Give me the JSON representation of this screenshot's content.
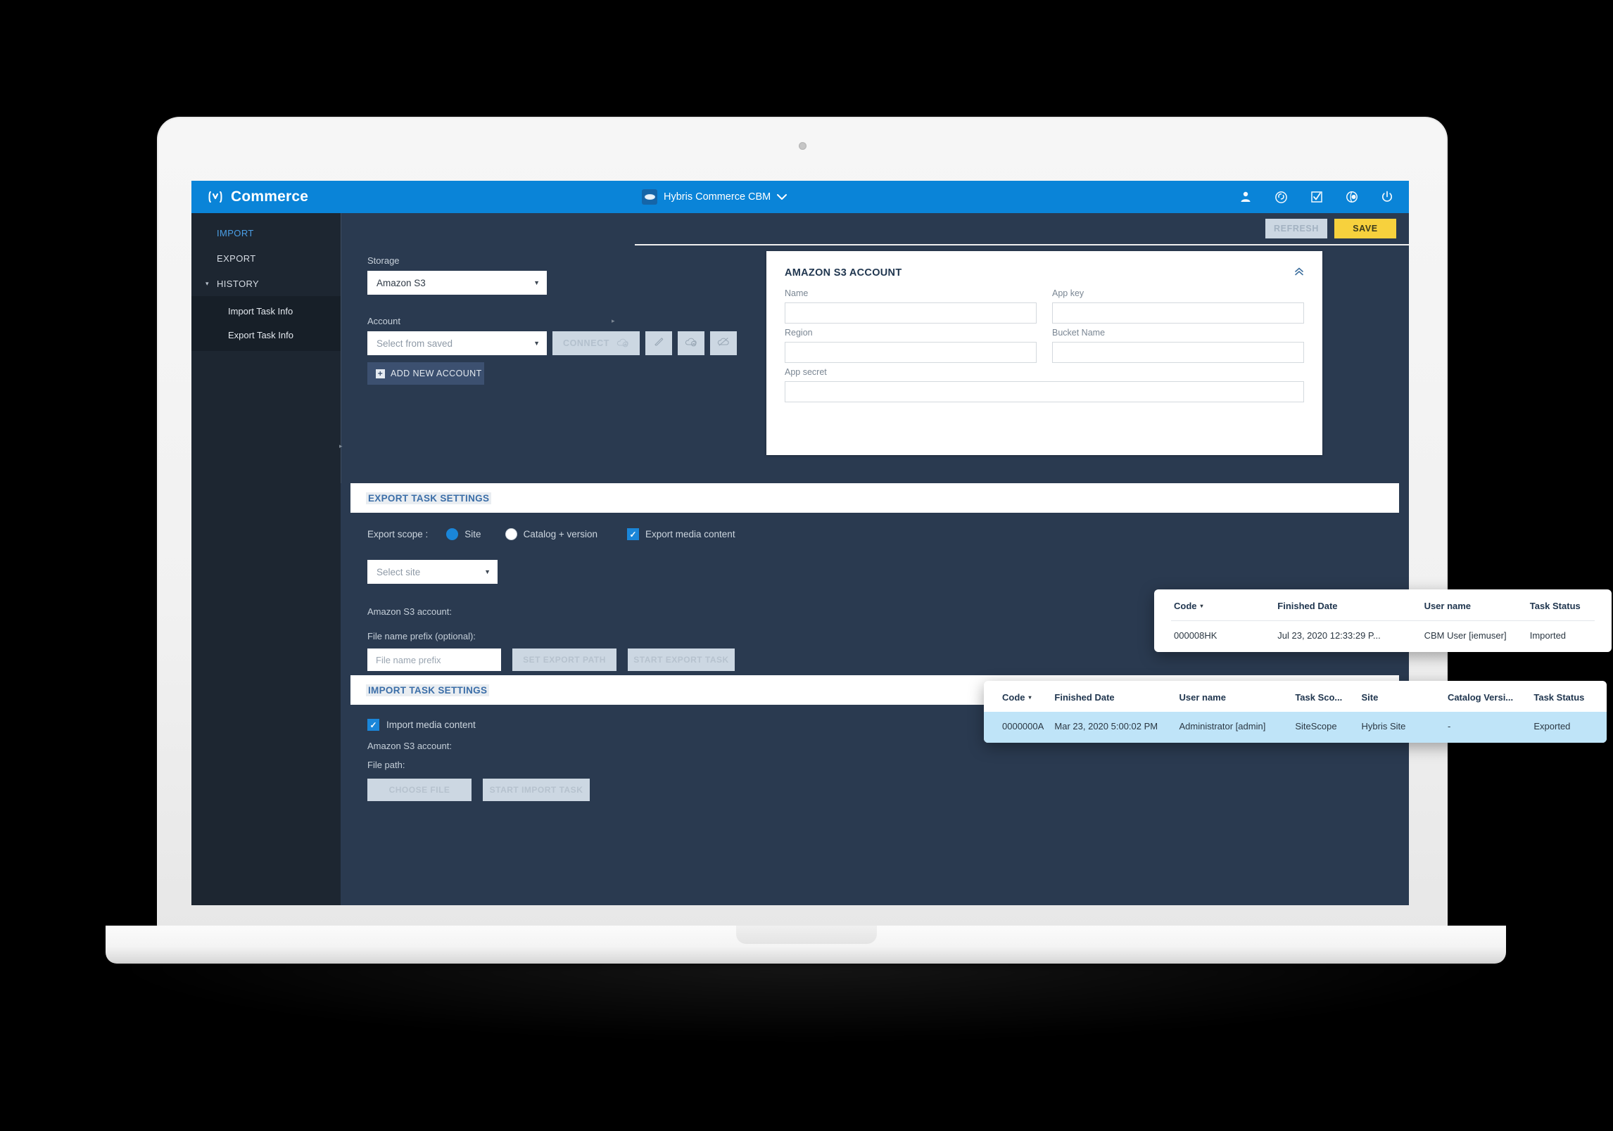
{
  "app": {
    "brand_title": "Commerce",
    "brand_logo_icon": "hybris-logo-icon",
    "tenant_label": "Hybris Commerce CBM",
    "tenant_caret": "⌄",
    "top_icons": [
      {
        "name": "user-icon"
      },
      {
        "name": "history-icon"
      },
      {
        "name": "tasks-checkbox-icon"
      },
      {
        "name": "globe-icon"
      },
      {
        "name": "power-icon"
      }
    ]
  },
  "sidebar": {
    "items": [
      {
        "label": "IMPORT",
        "active": true
      },
      {
        "label": "EXPORT",
        "active": false
      },
      {
        "label": "HISTORY",
        "active": false,
        "caret": "▾"
      }
    ],
    "sub_items": [
      {
        "label": "Import Task Info"
      },
      {
        "label": "Export Task Info"
      }
    ]
  },
  "toolbar": {
    "refresh_label": "REFRESH",
    "save_label": "SAVE"
  },
  "storage": {
    "storage_label": "Storage",
    "storage_value": "Amazon S3",
    "account_label": "Account",
    "account_placeholder": "Select from saved",
    "connect_label": "CONNECT",
    "add_account_label": "ADD NEW ACCOUNT",
    "plus_glyph": "+",
    "icon_buttons": [
      {
        "name": "cloud-add-icon"
      },
      {
        "name": "edit-pencil-icon"
      },
      {
        "name": "cloud-remove-icon"
      },
      {
        "name": "cloud-disconnect-icon"
      }
    ]
  },
  "s3_panel": {
    "title": "AMAZON S3 ACCOUNT",
    "collapse_glyph": "»",
    "fields": [
      {
        "label": "Name",
        "value": ""
      },
      {
        "label": "App key",
        "value": ""
      },
      {
        "label": "Region",
        "value": ""
      },
      {
        "label": "Bucket Name",
        "value": ""
      },
      {
        "label": "App secret",
        "value": ""
      }
    ]
  },
  "export_settings": {
    "header": "EXPORT TASK SETTINGS",
    "scope_label": "Export scope :",
    "scope_site": "Site",
    "scope_catalog": "Catalog + version",
    "media_label": "Export media content",
    "media_checked": true,
    "site_placeholder": "Select site",
    "amazon_account_label": "Amazon S3 account:",
    "prefix_label": "File name prefix (optional):",
    "prefix_placeholder": "File name prefix",
    "prefix_value": "",
    "set_export_path_label": "SET EXPORT PATH",
    "start_export_task_label": "START EXPORT TASK",
    "check_glyph": "✓"
  },
  "import_settings": {
    "header": "IMPORT TASK SETTINGS",
    "media_label": "Import media content",
    "media_checked": true,
    "amazon_account_label": "Amazon S3 account:",
    "file_path_label": "File path:",
    "choose_file_label": "CHOOSE FILE",
    "start_import_task_label": "START IMPORT TASK",
    "check_glyph": "✓"
  },
  "import_task_table": {
    "columns": [
      "Code",
      "Finished Date",
      "User name",
      "Task Status"
    ],
    "sort_column": "Code",
    "sort_glyph": "▾",
    "rows": [
      [
        "000008HK",
        "Jul 23, 2020 12:33:29 P...",
        "CBM User [iemuser]",
        "Imported"
      ]
    ]
  },
  "export_task_table": {
    "columns": [
      "Code",
      "Finished Date",
      "User name",
      "Task Sco...",
      "Site",
      "Catalog Versi...",
      "Task Status"
    ],
    "sort_column": "Code",
    "sort_glyph": "▾",
    "rows": [
      [
        "0000000A",
        "Mar 23, 2020 5:00:02 PM",
        "Administrator [admin]",
        "SiteScope",
        "Hybris Site",
        "-",
        "Exported"
      ]
    ]
  },
  "colors": {
    "brand_blue": "#0a84d8",
    "sidebar_bg": "#1d2631",
    "content_bg": "#2a3a50",
    "save_yellow": "#f7d13d",
    "accent_link": "#4b9fe6",
    "row_highlight": "#bfe4f8"
  }
}
